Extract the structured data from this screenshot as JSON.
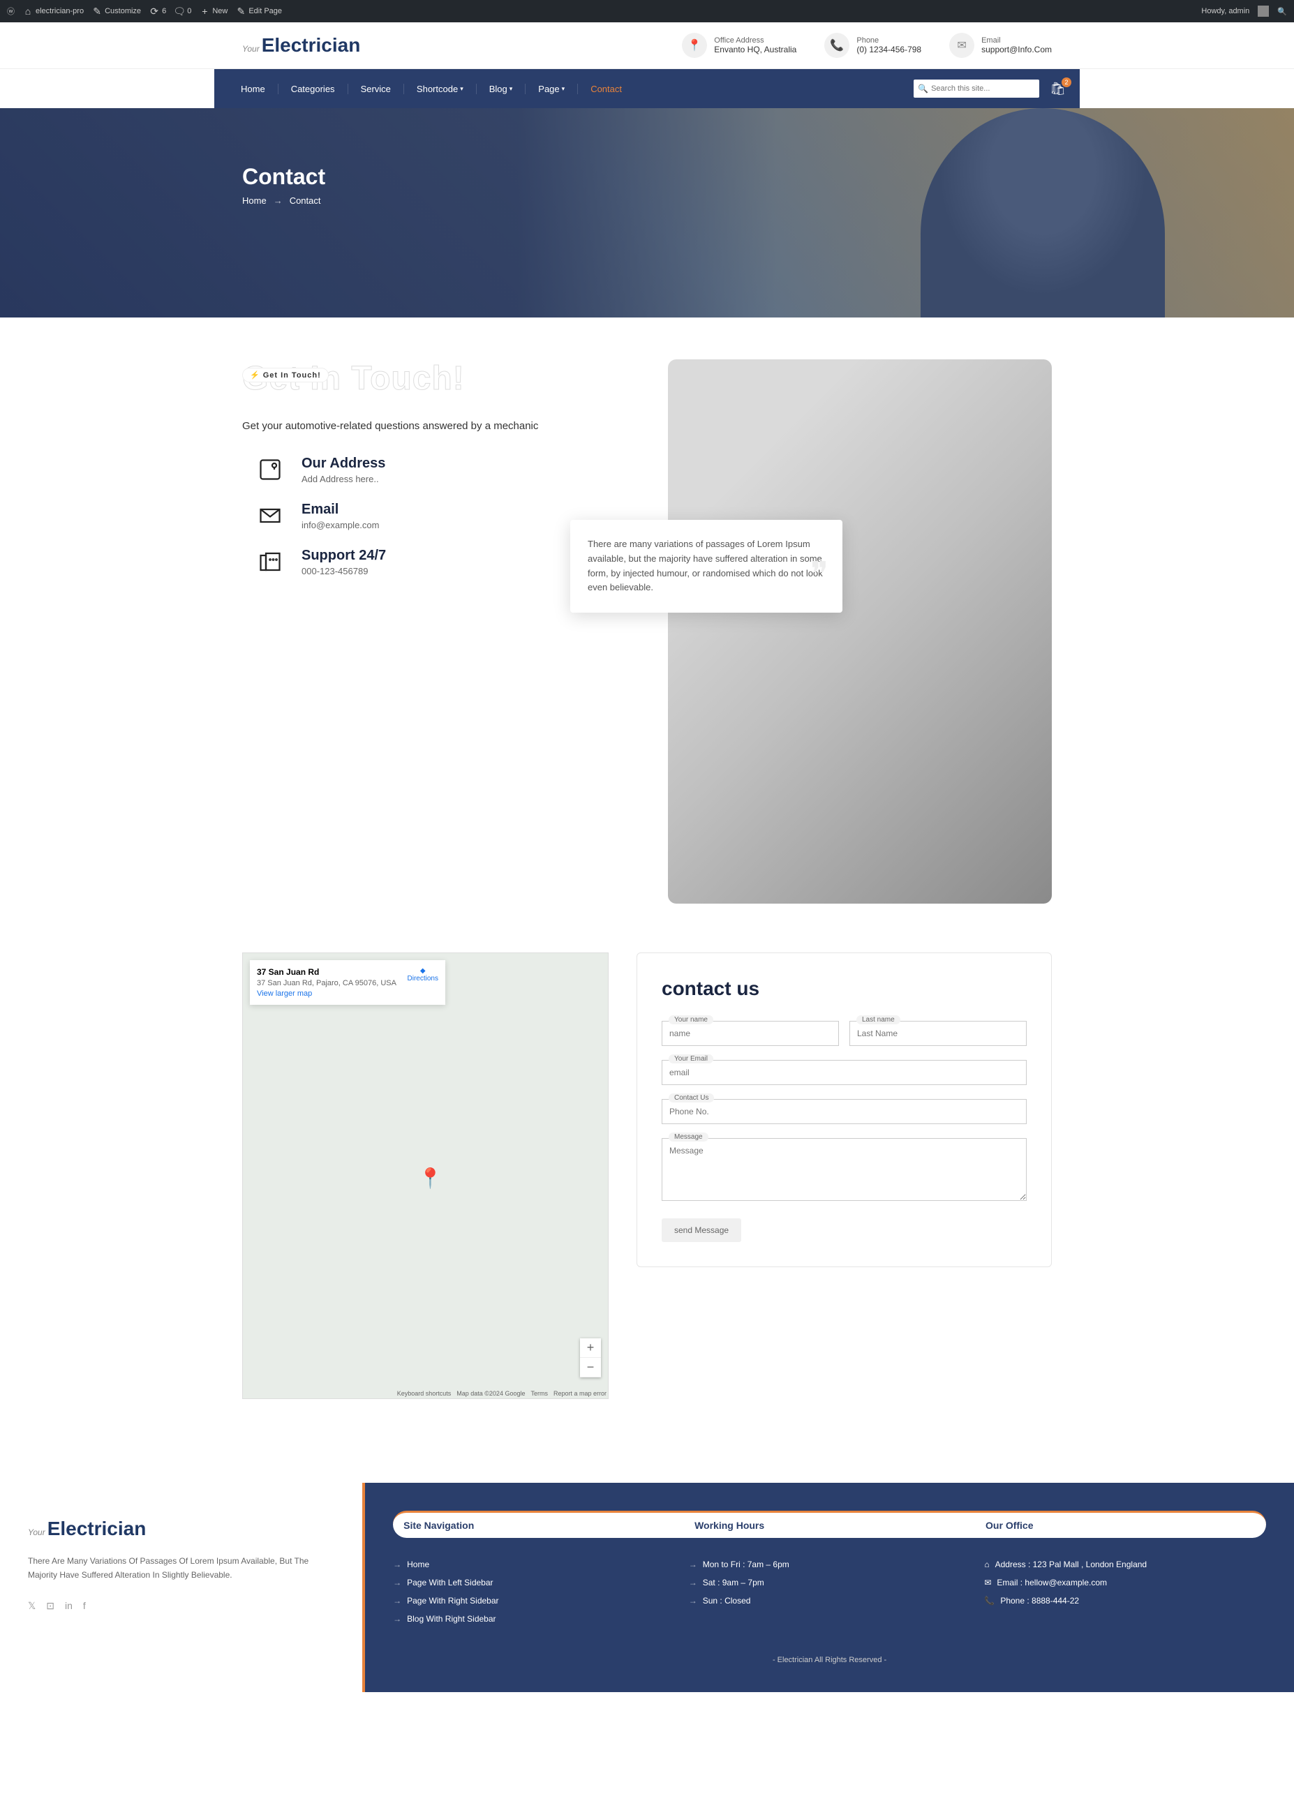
{
  "admin": {
    "site": "electrician-pro",
    "customize": "Customize",
    "updates": "6",
    "comments": "0",
    "new": "New",
    "edit": "Edit Page",
    "howdy": "Howdy, admin"
  },
  "header": {
    "logo_your": "Your",
    "logo_main": "Electrician",
    "office_label": "Office Address",
    "office_value": "Envanto HQ, Australia",
    "phone_label": "Phone",
    "phone_value": "(0) 1234-456-798",
    "email_label": "Email",
    "email_value": "support@Info.Com"
  },
  "nav": {
    "items": [
      {
        "label": "Home"
      },
      {
        "label": "Categories"
      },
      {
        "label": "Service"
      },
      {
        "label": "Shortcode",
        "dd": true
      },
      {
        "label": "Blog",
        "dd": true
      },
      {
        "label": "Page",
        "dd": true
      },
      {
        "label": "Contact",
        "active": true
      }
    ],
    "search_ph": "Search this site...",
    "cart_count": "2"
  },
  "hero": {
    "title": "Contact",
    "bc_home": "Home",
    "bc_current": "Contact"
  },
  "touch": {
    "badge": "Get In Touch!",
    "title": "Get In Touch!",
    "sub": "Get your automotive-related questions answered by a mechanic",
    "address_t": "Our Address",
    "address_v": "Add Address here..",
    "email_t": "Email",
    "email_v": "info@example.com",
    "support_t": "Support 24/7",
    "support_v": "000-123-456789",
    "quote": "There are many variations of passages of Lorem Ipsum available, but the majority have suffered alteration in some form, by injected humour, or randomised which do not look even believable."
  },
  "map": {
    "title": "37 San Juan Rd",
    "addr": "37 San Juan Rd, Pajaro, CA 95076, USA",
    "view": "View larger map",
    "directions": "Directions",
    "kb": "Keyboard shortcuts",
    "data": "Map data ©2024 Google",
    "terms": "Terms",
    "report": "Report a map error"
  },
  "form": {
    "title": "contact us",
    "name_l": "Your name",
    "name_ph": "name",
    "last_l": "Last name",
    "last_ph": "Last Name",
    "email_l": "Your Email",
    "email_ph": "email",
    "contact_l": "Contact Us",
    "contact_ph": "Phone No.",
    "msg_l": "Message",
    "msg_ph": "Message",
    "btn": "send Message"
  },
  "footer": {
    "desc": "There Are Many Variations Of Passages Of Lorem Ipsum Available, But The Majority Have Suffered Alteration In Slightly Believable.",
    "h1": "Site Navigation",
    "h2": "Working Hours",
    "h3": "Our Office",
    "nav": [
      "Home",
      "Page With Left Sidebar",
      "Page With Right Sidebar",
      "Blog With Right Sidebar"
    ],
    "hours": [
      "Mon to Fri : 7am – 6pm",
      "Sat : 9am – 7pm",
      "Sun : Closed"
    ],
    "office": [
      "Address : 123 Pal Mall , London England",
      "Email : hellow@example.com",
      "Phone : 8888-444-22"
    ],
    "copy": "- Electrician All Rights Reserved -"
  }
}
